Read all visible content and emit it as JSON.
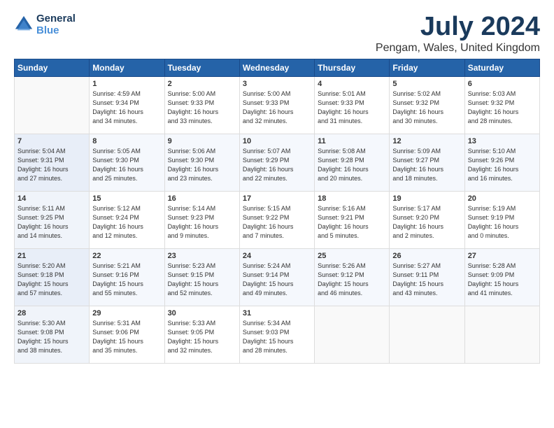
{
  "logo": {
    "line1": "General",
    "line2": "Blue"
  },
  "title": "July 2024",
  "location": "Pengam, Wales, United Kingdom",
  "days_of_week": [
    "Sunday",
    "Monday",
    "Tuesday",
    "Wednesday",
    "Thursday",
    "Friday",
    "Saturday"
  ],
  "weeks": [
    [
      {
        "day": "",
        "info": ""
      },
      {
        "day": "1",
        "info": "Sunrise: 4:59 AM\nSunset: 9:34 PM\nDaylight: 16 hours\nand 34 minutes."
      },
      {
        "day": "2",
        "info": "Sunrise: 5:00 AM\nSunset: 9:33 PM\nDaylight: 16 hours\nand 33 minutes."
      },
      {
        "day": "3",
        "info": "Sunrise: 5:00 AM\nSunset: 9:33 PM\nDaylight: 16 hours\nand 32 minutes."
      },
      {
        "day": "4",
        "info": "Sunrise: 5:01 AM\nSunset: 9:33 PM\nDaylight: 16 hours\nand 31 minutes."
      },
      {
        "day": "5",
        "info": "Sunrise: 5:02 AM\nSunset: 9:32 PM\nDaylight: 16 hours\nand 30 minutes."
      },
      {
        "day": "6",
        "info": "Sunrise: 5:03 AM\nSunset: 9:32 PM\nDaylight: 16 hours\nand 28 minutes."
      }
    ],
    [
      {
        "day": "7",
        "info": "Sunrise: 5:04 AM\nSunset: 9:31 PM\nDaylight: 16 hours\nand 27 minutes."
      },
      {
        "day": "8",
        "info": "Sunrise: 5:05 AM\nSunset: 9:30 PM\nDaylight: 16 hours\nand 25 minutes."
      },
      {
        "day": "9",
        "info": "Sunrise: 5:06 AM\nSunset: 9:30 PM\nDaylight: 16 hours\nand 23 minutes."
      },
      {
        "day": "10",
        "info": "Sunrise: 5:07 AM\nSunset: 9:29 PM\nDaylight: 16 hours\nand 22 minutes."
      },
      {
        "day": "11",
        "info": "Sunrise: 5:08 AM\nSunset: 9:28 PM\nDaylight: 16 hours\nand 20 minutes."
      },
      {
        "day": "12",
        "info": "Sunrise: 5:09 AM\nSunset: 9:27 PM\nDaylight: 16 hours\nand 18 minutes."
      },
      {
        "day": "13",
        "info": "Sunrise: 5:10 AM\nSunset: 9:26 PM\nDaylight: 16 hours\nand 16 minutes."
      }
    ],
    [
      {
        "day": "14",
        "info": "Sunrise: 5:11 AM\nSunset: 9:25 PM\nDaylight: 16 hours\nand 14 minutes."
      },
      {
        "day": "15",
        "info": "Sunrise: 5:12 AM\nSunset: 9:24 PM\nDaylight: 16 hours\nand 12 minutes."
      },
      {
        "day": "16",
        "info": "Sunrise: 5:14 AM\nSunset: 9:23 PM\nDaylight: 16 hours\nand 9 minutes."
      },
      {
        "day": "17",
        "info": "Sunrise: 5:15 AM\nSunset: 9:22 PM\nDaylight: 16 hours\nand 7 minutes."
      },
      {
        "day": "18",
        "info": "Sunrise: 5:16 AM\nSunset: 9:21 PM\nDaylight: 16 hours\nand 5 minutes."
      },
      {
        "day": "19",
        "info": "Sunrise: 5:17 AM\nSunset: 9:20 PM\nDaylight: 16 hours\nand 2 minutes."
      },
      {
        "day": "20",
        "info": "Sunrise: 5:19 AM\nSunset: 9:19 PM\nDaylight: 16 hours\nand 0 minutes."
      }
    ],
    [
      {
        "day": "21",
        "info": "Sunrise: 5:20 AM\nSunset: 9:18 PM\nDaylight: 15 hours\nand 57 minutes."
      },
      {
        "day": "22",
        "info": "Sunrise: 5:21 AM\nSunset: 9:16 PM\nDaylight: 15 hours\nand 55 minutes."
      },
      {
        "day": "23",
        "info": "Sunrise: 5:23 AM\nSunset: 9:15 PM\nDaylight: 15 hours\nand 52 minutes."
      },
      {
        "day": "24",
        "info": "Sunrise: 5:24 AM\nSunset: 9:14 PM\nDaylight: 15 hours\nand 49 minutes."
      },
      {
        "day": "25",
        "info": "Sunrise: 5:26 AM\nSunset: 9:12 PM\nDaylight: 15 hours\nand 46 minutes."
      },
      {
        "day": "26",
        "info": "Sunrise: 5:27 AM\nSunset: 9:11 PM\nDaylight: 15 hours\nand 43 minutes."
      },
      {
        "day": "27",
        "info": "Sunrise: 5:28 AM\nSunset: 9:09 PM\nDaylight: 15 hours\nand 41 minutes."
      }
    ],
    [
      {
        "day": "28",
        "info": "Sunrise: 5:30 AM\nSunset: 9:08 PM\nDaylight: 15 hours\nand 38 minutes."
      },
      {
        "day": "29",
        "info": "Sunrise: 5:31 AM\nSunset: 9:06 PM\nDaylight: 15 hours\nand 35 minutes."
      },
      {
        "day": "30",
        "info": "Sunrise: 5:33 AM\nSunset: 9:05 PM\nDaylight: 15 hours\nand 32 minutes."
      },
      {
        "day": "31",
        "info": "Sunrise: 5:34 AM\nSunset: 9:03 PM\nDaylight: 15 hours\nand 28 minutes."
      },
      {
        "day": "",
        "info": ""
      },
      {
        "day": "",
        "info": ""
      },
      {
        "day": "",
        "info": ""
      }
    ]
  ]
}
